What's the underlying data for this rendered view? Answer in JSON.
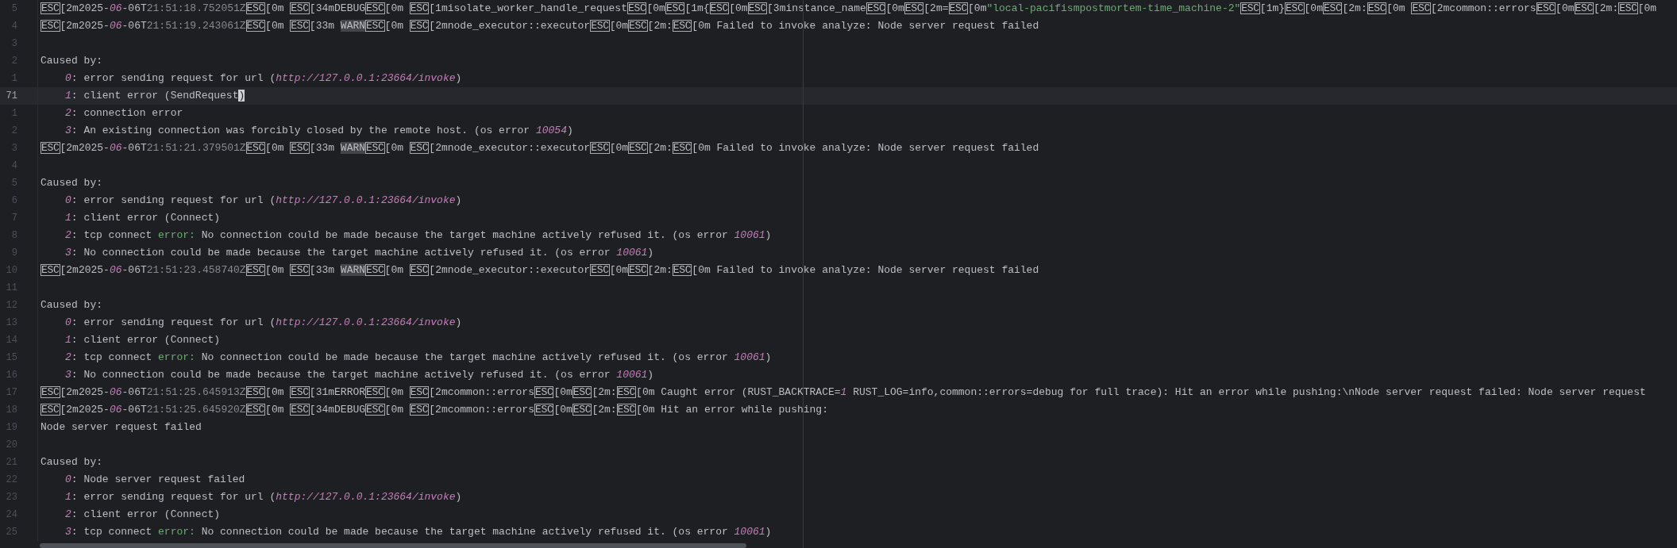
{
  "editor": {
    "lines": [
      {
        "number": "5",
        "current": false,
        "indented": false,
        "segments": [
          {
            "kind": "esc",
            "text": "ESC"
          },
          {
            "kind": "text",
            "text": "[2m2025-"
          },
          {
            "kind": "num",
            "text": "06"
          },
          {
            "kind": "text",
            "text": "-06T"
          },
          {
            "kind": "dim",
            "text": "21:51:18.752051Z"
          },
          {
            "kind": "esc",
            "text": "ESC"
          },
          {
            "kind": "text",
            "text": "[0m "
          },
          {
            "kind": "esc",
            "text": "ESC"
          },
          {
            "kind": "text",
            "text": "[34mDEBUG"
          },
          {
            "kind": "esc",
            "text": "ESC"
          },
          {
            "kind": "text",
            "text": "[0m "
          },
          {
            "kind": "esc",
            "text": "ESC"
          },
          {
            "kind": "text",
            "text": "[1misolate_worker_handle_request"
          },
          {
            "kind": "esc",
            "text": "ESC"
          },
          {
            "kind": "text",
            "text": "[0m"
          },
          {
            "kind": "esc",
            "text": "ESC"
          },
          {
            "kind": "text",
            "text": "[1m{"
          },
          {
            "kind": "esc",
            "text": "ESC"
          },
          {
            "kind": "text",
            "text": "[0m"
          },
          {
            "kind": "esc",
            "text": "ESC"
          },
          {
            "kind": "text",
            "text": "[3minstance_name"
          },
          {
            "kind": "esc",
            "text": "ESC"
          },
          {
            "kind": "text",
            "text": "[0m"
          },
          {
            "kind": "esc",
            "text": "ESC"
          },
          {
            "kind": "text",
            "text": "[2m="
          },
          {
            "kind": "esc",
            "text": "ESC"
          },
          {
            "kind": "text",
            "text": "[0m"
          },
          {
            "kind": "string",
            "text": "\"local-pacifismpostmortem-time_machine-2\""
          },
          {
            "kind": "esc",
            "text": "ESC"
          },
          {
            "kind": "text",
            "text": "[1m}"
          },
          {
            "kind": "esc",
            "text": "ESC"
          },
          {
            "kind": "text",
            "text": "[0m"
          },
          {
            "kind": "esc",
            "text": "ESC"
          },
          {
            "kind": "text",
            "text": "[2m:"
          },
          {
            "kind": "esc",
            "text": "ESC"
          },
          {
            "kind": "text",
            "text": "[0m "
          },
          {
            "kind": "esc",
            "text": "ESC"
          },
          {
            "kind": "text",
            "text": "[2mcommon::errors"
          },
          {
            "kind": "esc",
            "text": "ESC"
          },
          {
            "kind": "text",
            "text": "[0m"
          },
          {
            "kind": "esc",
            "text": "ESC"
          },
          {
            "kind": "text",
            "text": "[2m:"
          },
          {
            "kind": "esc",
            "text": "ESC"
          },
          {
            "kind": "text",
            "text": "[0m"
          }
        ]
      },
      {
        "number": "4",
        "current": false,
        "indented": false,
        "segments": [
          {
            "kind": "esc",
            "text": "ESC"
          },
          {
            "kind": "text",
            "text": "[2m2025-"
          },
          {
            "kind": "num",
            "text": "06"
          },
          {
            "kind": "text",
            "text": "-06T"
          },
          {
            "kind": "dim",
            "text": "21:51:19.243061Z"
          },
          {
            "kind": "esc",
            "text": "ESC"
          },
          {
            "kind": "text",
            "text": "[0m "
          },
          {
            "kind": "esc",
            "text": "ESC"
          },
          {
            "kind": "text",
            "text": "[33m "
          },
          {
            "kind": "highlight",
            "text": "WARN"
          },
          {
            "kind": "esc",
            "text": "ESC"
          },
          {
            "kind": "text",
            "text": "[0m "
          },
          {
            "kind": "esc",
            "text": "ESC"
          },
          {
            "kind": "text",
            "text": "[2mnode_executor::executor"
          },
          {
            "kind": "esc",
            "text": "ESC"
          },
          {
            "kind": "text",
            "text": "[0m"
          },
          {
            "kind": "esc",
            "text": "ESC"
          },
          {
            "kind": "text",
            "text": "[2m:"
          },
          {
            "kind": "esc",
            "text": "ESC"
          },
          {
            "kind": "text",
            "text": "[0m Failed to invoke analyze: Node server request failed"
          }
        ]
      },
      {
        "number": "3",
        "current": false
      },
      {
        "number": "2",
        "current": false,
        "indented": false,
        "segments": [
          {
            "kind": "text",
            "text": "Caused by:"
          }
        ]
      },
      {
        "number": "1",
        "current": false,
        "indented": true,
        "segments": [
          {
            "kind": "num",
            "text": "0"
          },
          {
            "kind": "text",
            "text": ": error sending request for url ("
          },
          {
            "kind": "num",
            "text": "http://127.0.0.1:23664/invoke"
          },
          {
            "kind": "text",
            "text": ")"
          }
        ]
      },
      {
        "number": "71",
        "current": true,
        "indented": true,
        "segments": [
          {
            "kind": "num",
            "text": "1"
          },
          {
            "kind": "text",
            "text": ": client error (SendRequest"
          },
          {
            "kind": "cursor",
            "text": ")"
          }
        ]
      },
      {
        "number": "1",
        "current": false,
        "indented": true,
        "segments": [
          {
            "kind": "num",
            "text": "2"
          },
          {
            "kind": "text",
            "text": ": connection error"
          }
        ]
      },
      {
        "number": "2",
        "current": false,
        "indented": true,
        "segments": [
          {
            "kind": "num",
            "text": "3"
          },
          {
            "kind": "text",
            "text": ": An existing connection was forcibly closed by the remote host. (os error "
          },
          {
            "kind": "num",
            "text": "10054"
          },
          {
            "kind": "text",
            "text": ")"
          }
        ]
      },
      {
        "number": "3",
        "current": false,
        "indented": false,
        "segments": [
          {
            "kind": "esc",
            "text": "ESC"
          },
          {
            "kind": "text",
            "text": "[2m2025-"
          },
          {
            "kind": "num",
            "text": "06"
          },
          {
            "kind": "text",
            "text": "-06T"
          },
          {
            "kind": "dim",
            "text": "21:51:21.379501Z"
          },
          {
            "kind": "esc",
            "text": "ESC"
          },
          {
            "kind": "text",
            "text": "[0m "
          },
          {
            "kind": "esc",
            "text": "ESC"
          },
          {
            "kind": "text",
            "text": "[33m "
          },
          {
            "kind": "highlight",
            "text": "WARN"
          },
          {
            "kind": "esc",
            "text": "ESC"
          },
          {
            "kind": "text",
            "text": "[0m "
          },
          {
            "kind": "esc",
            "text": "ESC"
          },
          {
            "kind": "text",
            "text": "[2mnode_executor::executor"
          },
          {
            "kind": "esc",
            "text": "ESC"
          },
          {
            "kind": "text",
            "text": "[0m"
          },
          {
            "kind": "esc",
            "text": "ESC"
          },
          {
            "kind": "text",
            "text": "[2m:"
          },
          {
            "kind": "esc",
            "text": "ESC"
          },
          {
            "kind": "text",
            "text": "[0m Failed to invoke analyze: Node server request failed"
          }
        ]
      },
      {
        "number": "4",
        "current": false
      },
      {
        "number": "5",
        "current": false,
        "indented": false,
        "segments": [
          {
            "kind": "text",
            "text": "Caused by:"
          }
        ]
      },
      {
        "number": "6",
        "current": false,
        "indented": true,
        "segments": [
          {
            "kind": "num",
            "text": "0"
          },
          {
            "kind": "text",
            "text": ": error sending request for url ("
          },
          {
            "kind": "num",
            "text": "http://127.0.0.1:23664/invoke"
          },
          {
            "kind": "text",
            "text": ")"
          }
        ]
      },
      {
        "number": "7",
        "current": false,
        "indented": true,
        "segments": [
          {
            "kind": "num",
            "text": "1"
          },
          {
            "kind": "text",
            "text": ": client error (Connect)"
          }
        ]
      },
      {
        "number": "8",
        "current": false,
        "indented": true,
        "segments": [
          {
            "kind": "num",
            "text": "2"
          },
          {
            "kind": "text",
            "text": ": tcp connect "
          },
          {
            "kind": "string",
            "text": "error:"
          },
          {
            "kind": "text",
            "text": " No connection could be made because the target machine actively refused it. (os error "
          },
          {
            "kind": "num",
            "text": "10061"
          },
          {
            "kind": "text",
            "text": ")"
          }
        ]
      },
      {
        "number": "9",
        "current": false,
        "indented": true,
        "segments": [
          {
            "kind": "num",
            "text": "3"
          },
          {
            "kind": "text",
            "text": ": No connection could be made because the target machine actively refused it. (os error "
          },
          {
            "kind": "num",
            "text": "10061"
          },
          {
            "kind": "text",
            "text": ")"
          }
        ]
      },
      {
        "number": "10",
        "current": false,
        "indented": false,
        "segments": [
          {
            "kind": "esc",
            "text": "ESC"
          },
          {
            "kind": "text",
            "text": "[2m2025-"
          },
          {
            "kind": "num",
            "text": "06"
          },
          {
            "kind": "text",
            "text": "-06T"
          },
          {
            "kind": "dim",
            "text": "21:51:23.458740Z"
          },
          {
            "kind": "esc",
            "text": "ESC"
          },
          {
            "kind": "text",
            "text": "[0m "
          },
          {
            "kind": "esc",
            "text": "ESC"
          },
          {
            "kind": "text",
            "text": "[33m "
          },
          {
            "kind": "highlight",
            "text": "WARN"
          },
          {
            "kind": "esc",
            "text": "ESC"
          },
          {
            "kind": "text",
            "text": "[0m "
          },
          {
            "kind": "esc",
            "text": "ESC"
          },
          {
            "kind": "text",
            "text": "[2mnode_executor::executor"
          },
          {
            "kind": "esc",
            "text": "ESC"
          },
          {
            "kind": "text",
            "text": "[0m"
          },
          {
            "kind": "esc",
            "text": "ESC"
          },
          {
            "kind": "text",
            "text": "[2m:"
          },
          {
            "kind": "esc",
            "text": "ESC"
          },
          {
            "kind": "text",
            "text": "[0m Failed to invoke analyze: Node server request failed"
          }
        ]
      },
      {
        "number": "11",
        "current": false
      },
      {
        "number": "12",
        "current": false,
        "indented": false,
        "segments": [
          {
            "kind": "text",
            "text": "Caused by:"
          }
        ]
      },
      {
        "number": "13",
        "current": false,
        "indented": true,
        "segments": [
          {
            "kind": "num",
            "text": "0"
          },
          {
            "kind": "text",
            "text": ": error sending request for url ("
          },
          {
            "kind": "num",
            "text": "http://127.0.0.1:23664/invoke"
          },
          {
            "kind": "text",
            "text": ")"
          }
        ]
      },
      {
        "number": "14",
        "current": false,
        "indented": true,
        "segments": [
          {
            "kind": "num",
            "text": "1"
          },
          {
            "kind": "text",
            "text": ": client error (Connect)"
          }
        ]
      },
      {
        "number": "15",
        "current": false,
        "indented": true,
        "segments": [
          {
            "kind": "num",
            "text": "2"
          },
          {
            "kind": "text",
            "text": ": tcp connect "
          },
          {
            "kind": "string",
            "text": "error:"
          },
          {
            "kind": "text",
            "text": " No connection could be made because the target machine actively refused it. (os error "
          },
          {
            "kind": "num",
            "text": "10061"
          },
          {
            "kind": "text",
            "text": ")"
          }
        ]
      },
      {
        "number": "16",
        "current": false,
        "indented": true,
        "segments": [
          {
            "kind": "num",
            "text": "3"
          },
          {
            "kind": "text",
            "text": ": No connection could be made because the target machine actively refused it. (os error "
          },
          {
            "kind": "num",
            "text": "10061"
          },
          {
            "kind": "text",
            "text": ")"
          }
        ]
      },
      {
        "number": "17",
        "current": false,
        "indented": false,
        "segments": [
          {
            "kind": "esc",
            "text": "ESC"
          },
          {
            "kind": "text",
            "text": "[2m2025-"
          },
          {
            "kind": "num",
            "text": "06"
          },
          {
            "kind": "text",
            "text": "-06T"
          },
          {
            "kind": "dim",
            "text": "21:51:25.645913Z"
          },
          {
            "kind": "esc",
            "text": "ESC"
          },
          {
            "kind": "text",
            "text": "[0m "
          },
          {
            "kind": "esc",
            "text": "ESC"
          },
          {
            "kind": "text",
            "text": "[31mERROR"
          },
          {
            "kind": "esc",
            "text": "ESC"
          },
          {
            "kind": "text",
            "text": "[0m "
          },
          {
            "kind": "esc",
            "text": "ESC"
          },
          {
            "kind": "text",
            "text": "[2mcommon::errors"
          },
          {
            "kind": "esc",
            "text": "ESC"
          },
          {
            "kind": "text",
            "text": "[0m"
          },
          {
            "kind": "esc",
            "text": "ESC"
          },
          {
            "kind": "text",
            "text": "[2m:"
          },
          {
            "kind": "esc",
            "text": "ESC"
          },
          {
            "kind": "text",
            "text": "[0m Caught error (RUST_BACKTRACE="
          },
          {
            "kind": "num",
            "text": "1"
          },
          {
            "kind": "text",
            "text": " RUST_LOG=info,common::errors=debug for full trace): Hit an error while pushing:\\nNode server request failed: Node server request"
          }
        ]
      },
      {
        "number": "18",
        "current": false,
        "indented": false,
        "segments": [
          {
            "kind": "esc",
            "text": "ESC"
          },
          {
            "kind": "text",
            "text": "[2m2025-"
          },
          {
            "kind": "num",
            "text": "06"
          },
          {
            "kind": "text",
            "text": "-06T"
          },
          {
            "kind": "dim",
            "text": "21:51:25.645920Z"
          },
          {
            "kind": "esc",
            "text": "ESC"
          },
          {
            "kind": "text",
            "text": "[0m "
          },
          {
            "kind": "esc",
            "text": "ESC"
          },
          {
            "kind": "text",
            "text": "[34mDEBUG"
          },
          {
            "kind": "esc",
            "text": "ESC"
          },
          {
            "kind": "text",
            "text": "[0m "
          },
          {
            "kind": "esc",
            "text": "ESC"
          },
          {
            "kind": "text",
            "text": "[2mcommon::errors"
          },
          {
            "kind": "esc",
            "text": "ESC"
          },
          {
            "kind": "text",
            "text": "[0m"
          },
          {
            "kind": "esc",
            "text": "ESC"
          },
          {
            "kind": "text",
            "text": "[2m:"
          },
          {
            "kind": "esc",
            "text": "ESC"
          },
          {
            "kind": "text",
            "text": "[0m Hit an error while pushing:"
          }
        ]
      },
      {
        "number": "19",
        "current": false,
        "indented": false,
        "segments": [
          {
            "kind": "text",
            "text": "Node server request failed"
          }
        ]
      },
      {
        "number": "20",
        "current": false
      },
      {
        "number": "21",
        "current": false,
        "indented": false,
        "segments": [
          {
            "kind": "text",
            "text": "Caused by:"
          }
        ]
      },
      {
        "number": "22",
        "current": false,
        "indented": true,
        "segments": [
          {
            "kind": "num",
            "text": "0"
          },
          {
            "kind": "text",
            "text": ": Node server request failed"
          }
        ]
      },
      {
        "number": "23",
        "current": false,
        "indented": true,
        "segments": [
          {
            "kind": "num",
            "text": "1"
          },
          {
            "kind": "text",
            "text": ": error sending request for url ("
          },
          {
            "kind": "num",
            "text": "http://127.0.0.1:23664/invoke"
          },
          {
            "kind": "text",
            "text": ")"
          }
        ]
      },
      {
        "number": "24",
        "current": false,
        "indented": true,
        "segments": [
          {
            "kind": "num",
            "text": "2"
          },
          {
            "kind": "text",
            "text": ": client error (Connect)"
          }
        ]
      },
      {
        "number": "25",
        "current": false,
        "indented": true,
        "segments": [
          {
            "kind": "num",
            "text": "3"
          },
          {
            "kind": "text",
            "text": ": tcp connect "
          },
          {
            "kind": "string",
            "text": "error:"
          },
          {
            "kind": "text",
            "text": " No connection could be made because the target machine actively refused it. (os error "
          },
          {
            "kind": "num",
            "text": "10061"
          },
          {
            "kind": "text",
            "text": ")"
          }
        ]
      }
    ]
  }
}
